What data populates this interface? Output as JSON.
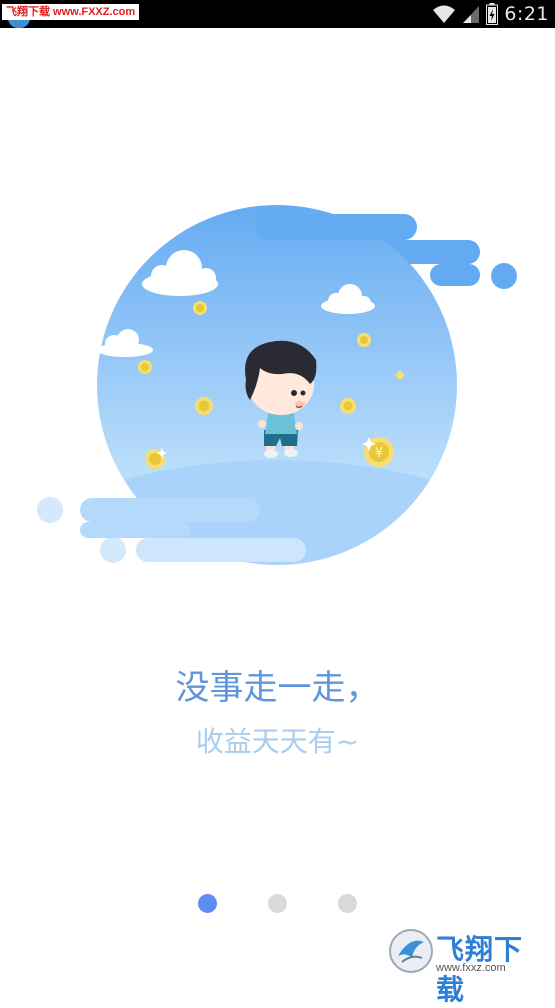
{
  "status_bar": {
    "watermark_text": "飞翔下载 www.FXXZ.com",
    "clock": "6:21",
    "icons": [
      "app-icon",
      "wifi-icon",
      "signal-icon",
      "battery-icon"
    ]
  },
  "onboarding": {
    "headline": "没事走一走，",
    "subline": "收益天天有~",
    "pages": 3,
    "active_page": 1,
    "colors": {
      "headline": "#5f95dc",
      "subline": "#a9cdf0",
      "dot_active": "#5c8ef0",
      "dot_inactive": "#d9d9d9",
      "sky": "#6fb2f3"
    }
  },
  "watermark": {
    "brand": "飞翔下载",
    "url": "www.fxxz.com"
  }
}
